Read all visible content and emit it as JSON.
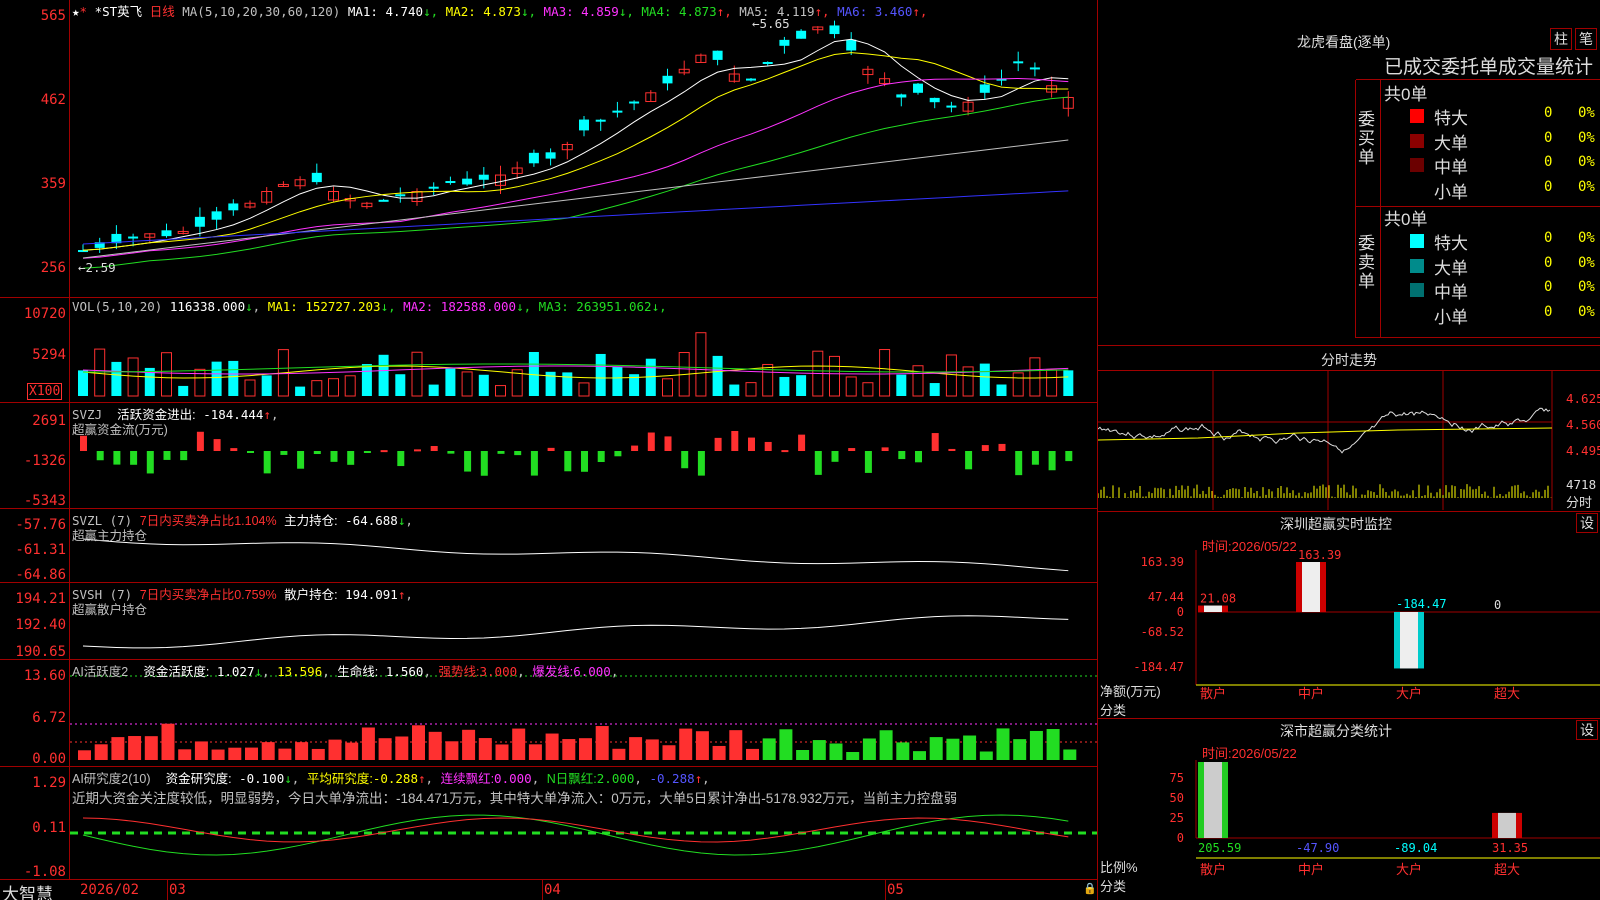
{
  "brand": "大智慧",
  "kline": {
    "stock_name": "*ST英飞",
    "period": "日线",
    "ma_label": "MA(5,10,20,30,60,120)",
    "ma_values": [
      {
        "name": "MA1",
        "value": "4.740",
        "arrow": "↓",
        "color": "#ffffff"
      },
      {
        "name": "MA2",
        "value": "4.873",
        "arrow": "↓",
        "color": "#ffff00"
      },
      {
        "name": "MA3",
        "value": "4.859",
        "arrow": "↓",
        "color": "#ff33ff"
      },
      {
        "name": "MA4",
        "value": "4.873",
        "arrow": "↑",
        "color": "#22dd22"
      },
      {
        "name": "MA5",
        "value": "4.119",
        "arrow": "↑",
        "color": "#c0c0c0"
      },
      {
        "name": "MA6",
        "value": "3.460",
        "arrow": "↑",
        "color": "#5555ff"
      }
    ],
    "yticks": [
      "565",
      "462",
      "359",
      "256"
    ],
    "high_mark": "5.65",
    "low_mark": "2.59"
  },
  "vol": {
    "label": "VOL(5,10,20)",
    "value": "116338.000",
    "arrow": "↓",
    "mas": [
      {
        "name": "MA1",
        "value": "152727.203",
        "arrow": "↓",
        "color": "#ffff00"
      },
      {
        "name": "MA2",
        "value": "182588.000",
        "arrow": "↓",
        "color": "#ff33ff"
      },
      {
        "name": "MA3",
        "value": "263951.062",
        "arrow": "↓",
        "color": "#22dd22"
      }
    ],
    "yticks": [
      "10720",
      "5294"
    ],
    "unit": "X100"
  },
  "svzj": {
    "label": "SVZJ",
    "title": "活跃资金进出:",
    "value": "-184.444",
    "arrow": "↑",
    "sub": "超赢资金流(万元)",
    "yticks": [
      "2691",
      "-1326",
      "-5343"
    ]
  },
  "svzl": {
    "label": "SVZL (7)",
    "ratio_text": "7日内买卖净占比1.104%",
    "title": "主力持仓:",
    "value": "-64.688",
    "arrow": "↓",
    "sub": "超赢主力持仓",
    "yticks": [
      "-57.76",
      "-61.31",
      "-64.86"
    ]
  },
  "svsh": {
    "label": "SVSH (7)",
    "ratio_text": "7日内买卖净占比0.759%",
    "title": "散户持仓:",
    "value": "194.091",
    "arrow": "↑",
    "sub": "超赢散户持仓",
    "yticks": [
      "194.21",
      "192.40",
      "190.65"
    ]
  },
  "ai_active": {
    "label": "AI活跃度2",
    "title": "资金活跃度:",
    "value": "1.027",
    "arrow": "↓",
    "v2": "13.596",
    "life_title": "生命线:",
    "life": "1.560",
    "strong_title": "强势线:",
    "strong": "3.000",
    "burst_title": "爆发线:",
    "burst": "6.000",
    "yticks": [
      "13.60",
      "6.72",
      "0.00"
    ]
  },
  "ai_research": {
    "label": "AI研究度2(10)",
    "t1": "资金研究度:",
    "v1": "-0.100",
    "a1": "↓",
    "t2": "平均研究度:",
    "v2": "-0.288",
    "a2": "↑",
    "t3": "连续飘红:",
    "v3": "0.000",
    "t4": "N日飘红:",
    "v4": "2.000",
    "v5": "-0.288",
    "a5": "↑",
    "comment": "近期大资金关注度较低，明显弱势，今日大单净流出：-184.471万元，其中特大单净流入：0万元，大单5日累计净出-5178.932万元，当前主力控盘弱",
    "yticks": [
      "1.29",
      "0.11",
      "-1.08"
    ]
  },
  "xaxis": [
    "2026/02",
    "03",
    "04",
    "05"
  ],
  "right": {
    "lhb_title": "龙虎看盘(逐单)",
    "btn_bar": "柱",
    "btn_pen": "笔",
    "tabs": [
      "已成交",
      "委托单",
      "成交量统计"
    ],
    "buy": {
      "side": "委买单",
      "total": "共0单",
      "rows": [
        {
          "name": "特大",
          "n": "0",
          "p": "0%",
          "color": "#ff0000"
        },
        {
          "name": "大单",
          "n": "0",
          "p": "0%",
          "color": "#8b0000"
        },
        {
          "name": "中单",
          "n": "0",
          "p": "0%",
          "color": "#6b0000"
        },
        {
          "name": "小单",
          "n": "0",
          "p": "0%",
          "color": "#000000"
        }
      ]
    },
    "sell": {
      "side": "委卖单",
      "total": "共0单",
      "rows": [
        {
          "name": "特大",
          "n": "0",
          "p": "0%",
          "color": "#00ffff"
        },
        {
          "name": "大单",
          "n": "0",
          "p": "0%",
          "color": "#008b8b"
        },
        {
          "name": "中单",
          "n": "0",
          "p": "0%",
          "color": "#007070"
        },
        {
          "name": "小单",
          "n": "0",
          "p": "0%",
          "color": "#000000"
        }
      ]
    },
    "intraday": {
      "title": "分时走势",
      "yticks": [
        "4.625",
        "4.560",
        "4.495"
      ],
      "vol_label": "4718",
      "unit": "分时"
    },
    "sz_monitor": {
      "title": "深圳超赢实时监控",
      "set": "设",
      "time_label": "时间:",
      "time": "2026/05/22",
      "yticks": [
        "163.39",
        "47.44",
        "0",
        "-68.52",
        "-184.47"
      ],
      "ylabel1": "净额(万元)",
      "ylabel2": "分类",
      "cats": [
        "散户",
        "中户",
        "大户",
        "超大"
      ],
      "vals": [
        "21.08",
        "163.39",
        "-184.47",
        "0"
      ]
    },
    "sz_class": {
      "title": "深市超赢分类统计",
      "set": "设",
      "time_label": "时间:",
      "time": "2026/05/22",
      "yticks": [
        "75",
        "50",
        "25",
        "0"
      ],
      "ylabel1": "比例%",
      "ylabel2": "分类",
      "cats": [
        "散户",
        "中户",
        "大户",
        "超大"
      ],
      "vals": [
        "205.59",
        "-47.90",
        "-89.04",
        "31.35"
      ]
    }
  }
}
